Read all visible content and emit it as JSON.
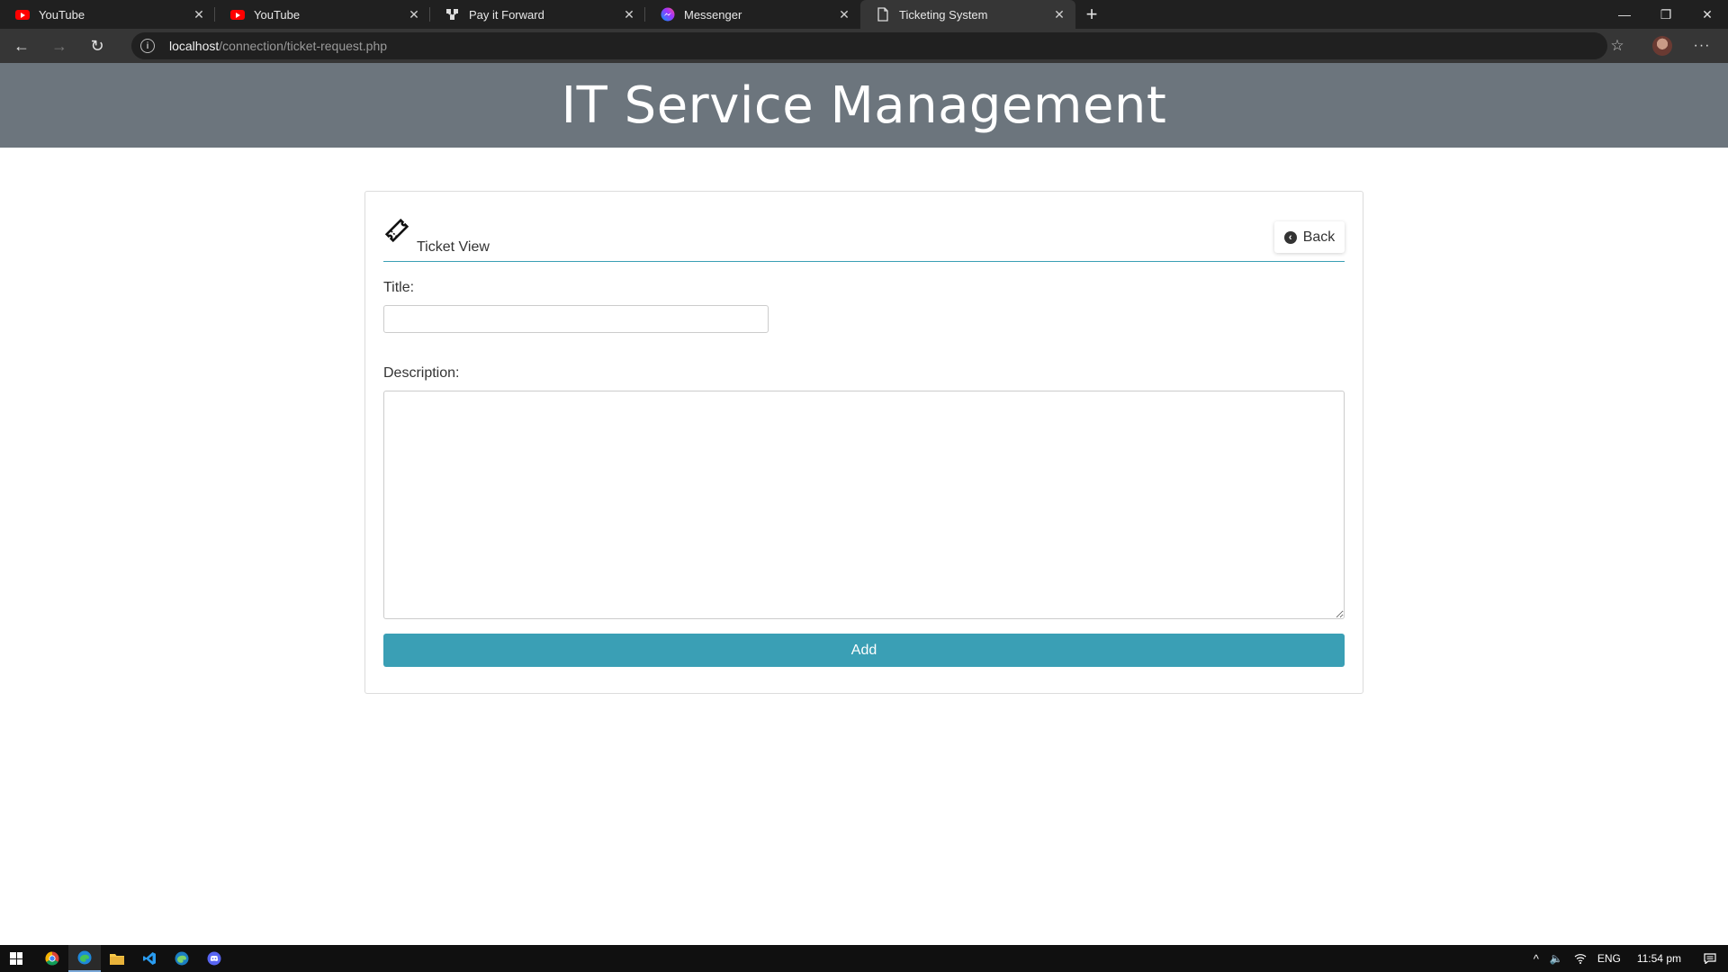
{
  "browser": {
    "tabs": [
      {
        "title": "YouTube",
        "icon": "youtube-icon"
      },
      {
        "title": "YouTube",
        "icon": "youtube-icon"
      },
      {
        "title": "Pay it Forward",
        "icon": "gitkraken-icon"
      },
      {
        "title": "Messenger",
        "icon": "messenger-icon"
      },
      {
        "title": "Ticketing System",
        "icon": "page-icon"
      }
    ],
    "url_host": "localhost",
    "url_path": "/connection/ticket-request.php"
  },
  "page": {
    "header": "IT Service Management",
    "card_title": "Ticket View",
    "back_label": "Back",
    "title_label": "Title:",
    "title_value": "",
    "description_label": "Description:",
    "description_value": "",
    "add_label": "Add"
  },
  "taskbar": {
    "language": "ENG",
    "time": "11:54 pm"
  },
  "colors": {
    "header_bg": "#6c757d",
    "accent": "#3a9fb5"
  }
}
